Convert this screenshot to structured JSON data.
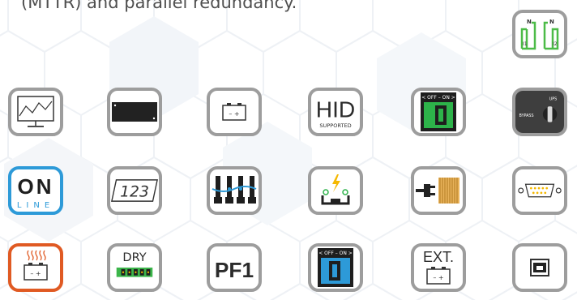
{
  "caption": {
    "text": "(MTTR) and parallel redundancy."
  },
  "icons": {
    "switch": {
      "n_left": "N",
      "n_right": "N",
      "i1": "I1",
      "i2": "I2",
      "accent": "#4cbb47"
    },
    "hid": {
      "main": "HID",
      "sub": "SUPPORTED"
    },
    "switch_green": {
      "label": "< OFF – ON >",
      "color": "#2db34a"
    },
    "bypass": {
      "ups": "UPS",
      "bypass": "BYPASS"
    },
    "online": {
      "main": "ON",
      "sub": "LINE",
      "border": "#2d9ad8"
    },
    "counter": {
      "text": "123"
    },
    "dry": {
      "label": "DRY",
      "color": "#3bb54a"
    },
    "pf": {
      "text": "PF1"
    },
    "switch_blue": {
      "label": "< OFF – ON >",
      "color": "#2d9ad8"
    },
    "ext": {
      "label": "EXT."
    },
    "heater": {
      "border": "#e05a23"
    },
    "battery_sign": "– +"
  }
}
